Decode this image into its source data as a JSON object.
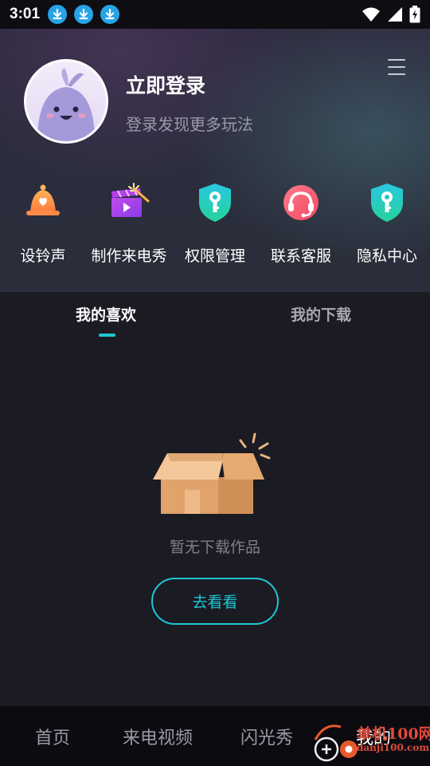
{
  "status_bar": {
    "time": "3:01",
    "download_icons": [
      "download-icon",
      "download-icon",
      "download-icon"
    ],
    "right_icons": [
      "wifi-icon",
      "signal-icon",
      "battery-charging-icon"
    ]
  },
  "profile": {
    "login_title": "立即登录",
    "login_subtitle": "登录发现更多玩法"
  },
  "shortcuts": [
    {
      "label": "设铃声",
      "icon": "bell-icon"
    },
    {
      "label": "制作来电秀",
      "icon": "clapperboard-icon"
    },
    {
      "label": "权限管理",
      "icon": "key-shield-icon"
    },
    {
      "label": "联系客服",
      "icon": "headset-icon"
    },
    {
      "label": "隐私中心",
      "icon": "key-shield-icon"
    }
  ],
  "tabs": {
    "likes": "我的喜欢",
    "downloads": "我的下载",
    "active": "likes"
  },
  "empty_state": {
    "message": "暂无下载作品",
    "button": "去看看"
  },
  "bottom_nav": {
    "items": [
      "首页",
      "来电视频",
      "闪光秀",
      "我的"
    ],
    "active": "我的"
  },
  "watermark": {
    "line1": "单机100网",
    "line2": "danji100.com"
  },
  "colors": {
    "accent": "#1fc7d4",
    "background": "#1b1b24",
    "header_bg": "#2e2a3e",
    "nav_bg": "#0b0b10"
  }
}
